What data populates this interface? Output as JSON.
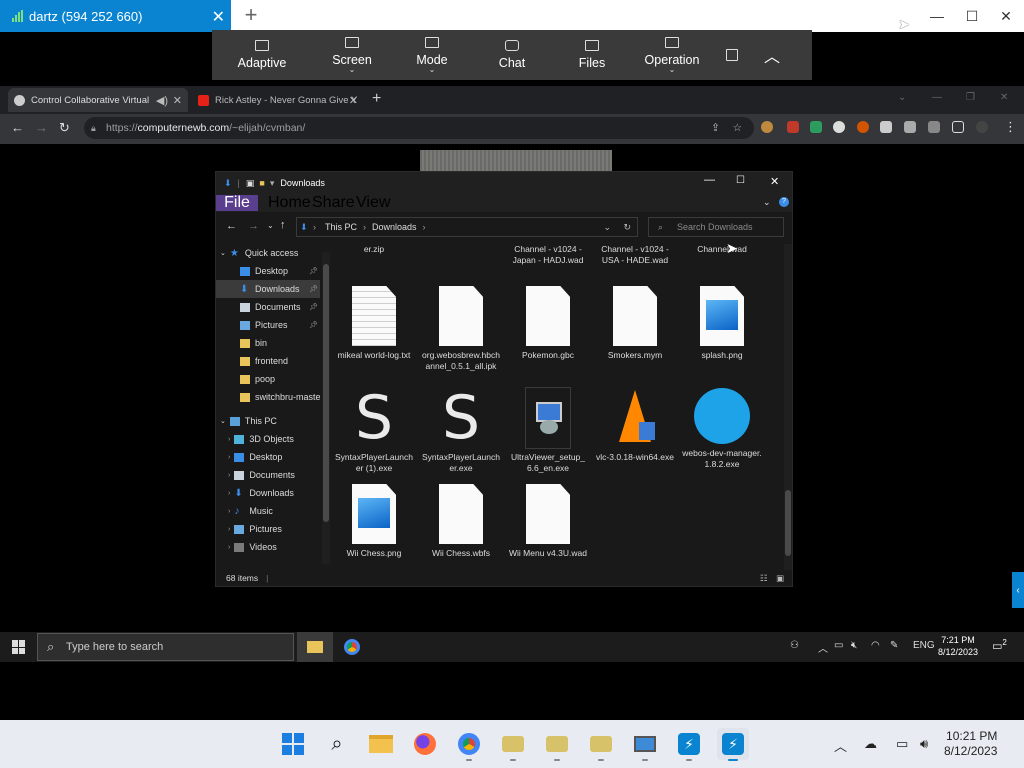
{
  "anydesk": {
    "session_title": "dartz (594 252 660)",
    "toolbar": [
      {
        "label": "Adaptive",
        "icon": "fit-screen-icon"
      },
      {
        "label": "Screen",
        "icon": "monitor-icon"
      },
      {
        "label": "Mode",
        "icon": "image-icon"
      },
      {
        "label": "Chat",
        "icon": "chat-icon"
      },
      {
        "label": "Files",
        "icon": "folder-icon"
      },
      {
        "label": "Operation",
        "icon": "keyboard-icon"
      }
    ]
  },
  "chrome": {
    "tabs": [
      {
        "title": "Control Collaborative Virtual",
        "active": true
      },
      {
        "title": "Rick Astley - Never Gonna Give Y",
        "active": false
      }
    ],
    "url_prefix": "https://",
    "url_host": "computernewb.com",
    "url_path": "/~elijah/cvmban/"
  },
  "explorer": {
    "title": "Downloads",
    "ribbon": [
      "File",
      "Home",
      "Share",
      "View"
    ],
    "breadcrumb": [
      "This PC",
      "Downloads"
    ],
    "search_placeholder": "Search Downloads",
    "sidebar": [
      {
        "label": "Quick access",
        "icon": "star-icon",
        "level": 0
      },
      {
        "label": "Desktop",
        "icon": "desktop-icon",
        "level": 1,
        "pinned": true
      },
      {
        "label": "Downloads",
        "icon": "download-icon",
        "level": 1,
        "pinned": true,
        "selected": true
      },
      {
        "label": "Documents",
        "icon": "documents-icon",
        "level": 1,
        "pinned": true
      },
      {
        "label": "Pictures",
        "icon": "pictures-icon",
        "level": 1,
        "pinned": true
      },
      {
        "label": "bin",
        "icon": "folder-icon",
        "level": 1
      },
      {
        "label": "frontend",
        "icon": "folder-icon",
        "level": 1
      },
      {
        "label": "poop",
        "icon": "folder-icon",
        "level": 1
      },
      {
        "label": "switchbru-maste",
        "icon": "folder-icon",
        "level": 1
      },
      {
        "label": "This PC",
        "icon": "pc-icon",
        "level": 0
      },
      {
        "label": "3D Objects",
        "icon": "cube-icon",
        "level": 1
      },
      {
        "label": "Desktop",
        "icon": "desktop-icon",
        "level": 1
      },
      {
        "label": "Documents",
        "icon": "documents-icon",
        "level": 1
      },
      {
        "label": "Downloads",
        "icon": "download-icon",
        "level": 1
      },
      {
        "label": "Music",
        "icon": "music-icon",
        "level": 1
      },
      {
        "label": "Pictures",
        "icon": "pictures-icon",
        "level": 1
      },
      {
        "label": "Videos",
        "icon": "videos-icon",
        "level": 1
      }
    ],
    "top_row": [
      "er.zip",
      "Channel - v1024 - Japan - HADJ.wad",
      "Channel - v1024 - USA - HADE.wad",
      "Channel.wad"
    ],
    "files": [
      {
        "name": "mikeal world-log.txt",
        "icon": "text-file-icon"
      },
      {
        "name": "org.webosbrew.hbchannel_0.5.1_all.ipk",
        "icon": "file-icon"
      },
      {
        "name": "Pokemon.gbc",
        "icon": "file-icon"
      },
      {
        "name": "Smokers.mym",
        "icon": "file-icon"
      },
      {
        "name": "splash.png",
        "icon": "image-file-icon"
      },
      {
        "name": "SyntaxPlayerLauncher (1).exe",
        "icon": "syntax-s-icon"
      },
      {
        "name": "SyntaxPlayerLauncher.exe",
        "icon": "syntax-s-icon"
      },
      {
        "name": "UltraViewer_setup_6.6_en.exe",
        "icon": "installer-icon"
      },
      {
        "name": "vlc-3.0.18-win64.exe",
        "icon": "vlc-cone-icon"
      },
      {
        "name": "webos-dev-manager.1.8.2.exe",
        "icon": "webos-icon"
      },
      {
        "name": "Wii Chess.png",
        "icon": "image-file-icon"
      },
      {
        "name": "Wii Chess.wbfs",
        "icon": "file-icon"
      },
      {
        "name": "Wii Menu v4.3U.wad",
        "icon": "file-icon"
      }
    ],
    "status": "68 items"
  },
  "remote_taskbar": {
    "search_placeholder": "Type here to search",
    "language": "ENG",
    "time": "7:21 PM",
    "date": "8/12/2023",
    "notifications": "2"
  },
  "local_taskbar": {
    "time": "10:21 PM",
    "date": "8/12/2023"
  }
}
